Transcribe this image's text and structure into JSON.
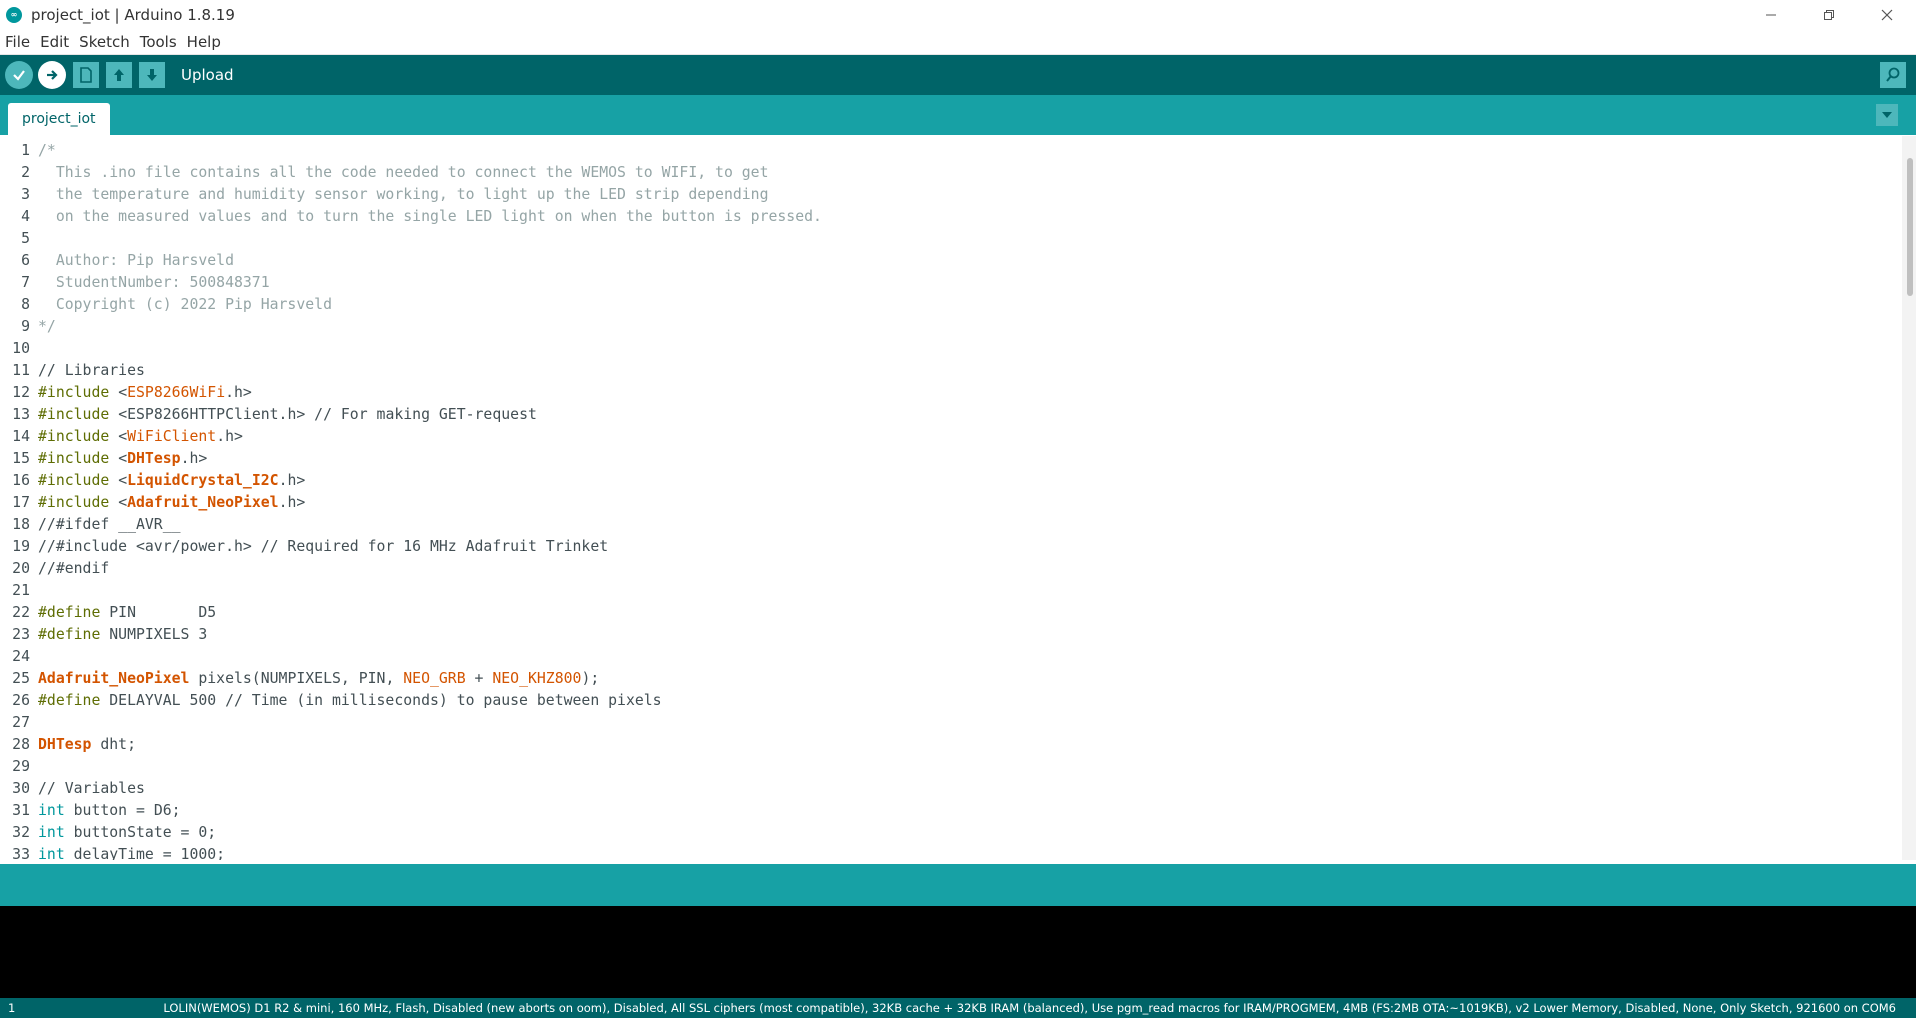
{
  "window": {
    "title": "project_iot | Arduino 1.8.19",
    "controls": [
      "minimize-icon",
      "restore-icon",
      "close-icon"
    ]
  },
  "menu": [
    "File",
    "Edit",
    "Sketch",
    "Tools",
    "Help"
  ],
  "toolbar": {
    "hover_label": "Upload",
    "buttons": [
      "verify-icon",
      "upload-icon",
      "new-icon",
      "open-icon",
      "save-icon"
    ],
    "serial_monitor_icon": "magnifier-icon"
  },
  "tabs": [
    {
      "label": "project_iot"
    }
  ],
  "editor": {
    "lines": [
      {
        "n": "1",
        "segs": [
          [
            "cm",
            "/*"
          ]
        ]
      },
      {
        "n": "2",
        "segs": [
          [
            "cm",
            "  This .ino file contains all the code needed to connect the WEMOS to WIFI, to get"
          ]
        ]
      },
      {
        "n": "3",
        "segs": [
          [
            "cm",
            "  the temperature and humidity sensor working, to light up the LED strip depending"
          ]
        ]
      },
      {
        "n": "4",
        "segs": [
          [
            "cm",
            "  on the measured values and to turn the single LED light on when the button is pressed."
          ]
        ]
      },
      {
        "n": "5",
        "segs": [
          [
            "cm",
            ""
          ]
        ]
      },
      {
        "n": "6",
        "segs": [
          [
            "cm",
            "  Author: Pip Harsveld"
          ]
        ]
      },
      {
        "n": "7",
        "segs": [
          [
            "cm",
            "  StudentNumber: 500848371"
          ]
        ]
      },
      {
        "n": "8",
        "segs": [
          [
            "cm",
            "  Copyright (c) 2022 Pip Harsveld"
          ]
        ]
      },
      {
        "n": "9",
        "segs": [
          [
            "cm",
            "*/"
          ]
        ]
      },
      {
        "n": "10",
        "segs": []
      },
      {
        "n": "11",
        "segs": [
          [
            "",
            "// Libraries"
          ]
        ]
      },
      {
        "n": "12",
        "segs": [
          [
            "pp",
            "#include"
          ],
          [
            "",
            " <"
          ],
          [
            "cls",
            "ESP8266WiFi"
          ],
          [
            "",
            ".h>"
          ]
        ]
      },
      {
        "n": "13",
        "segs": [
          [
            "pp",
            "#include"
          ],
          [
            "",
            " <ESP8266HTTPClient.h> // For making GET-request"
          ]
        ]
      },
      {
        "n": "14",
        "segs": [
          [
            "pp",
            "#include"
          ],
          [
            "",
            " <"
          ],
          [
            "cls",
            "WiFiClient"
          ],
          [
            "",
            ".h>"
          ]
        ]
      },
      {
        "n": "15",
        "segs": [
          [
            "pp",
            "#include"
          ],
          [
            "",
            " <"
          ],
          [
            "cls-b",
            "DHTesp"
          ],
          [
            "",
            ".h>"
          ]
        ]
      },
      {
        "n": "16",
        "segs": [
          [
            "pp",
            "#include"
          ],
          [
            "",
            " <"
          ],
          [
            "cls-b",
            "LiquidCrystal_I2C"
          ],
          [
            "",
            ".h>"
          ]
        ]
      },
      {
        "n": "17",
        "segs": [
          [
            "pp",
            "#include"
          ],
          [
            "",
            " <"
          ],
          [
            "cls-b",
            "Adafruit_NeoPixel"
          ],
          [
            "",
            ".h>"
          ]
        ]
      },
      {
        "n": "18",
        "segs": [
          [
            "",
            "//#ifdef __AVR__"
          ]
        ]
      },
      {
        "n": "19",
        "segs": [
          [
            "",
            "//#include <avr/power.h> // Required for 16 MHz Adafruit Trinket"
          ]
        ]
      },
      {
        "n": "20",
        "segs": [
          [
            "",
            "//#endif"
          ]
        ]
      },
      {
        "n": "21",
        "segs": []
      },
      {
        "n": "22",
        "segs": [
          [
            "pp",
            "#define"
          ],
          [
            "",
            " PIN       D5"
          ]
        ]
      },
      {
        "n": "23",
        "segs": [
          [
            "pp",
            "#define"
          ],
          [
            "",
            " NUMPIXELS 3"
          ]
        ]
      },
      {
        "n": "24",
        "segs": []
      },
      {
        "n": "25",
        "segs": [
          [
            "cls-b",
            "Adafruit_NeoPixel"
          ],
          [
            "",
            " pixels(NUMPIXELS, PIN, "
          ],
          [
            "cls",
            "NEO_GRB"
          ],
          [
            "",
            " + "
          ],
          [
            "cls",
            "NEO_KHZ800"
          ],
          [
            "",
            ");"
          ]
        ]
      },
      {
        "n": "26",
        "segs": [
          [
            "pp",
            "#define"
          ],
          [
            "",
            " DELAYVAL 500 // Time (in milliseconds) to pause between pixels"
          ]
        ]
      },
      {
        "n": "27",
        "segs": []
      },
      {
        "n": "28",
        "segs": [
          [
            "cls-b",
            "DHTesp"
          ],
          [
            "",
            " dht;"
          ]
        ]
      },
      {
        "n": "29",
        "segs": []
      },
      {
        "n": "30",
        "segs": [
          [
            "",
            "// Variables"
          ]
        ]
      },
      {
        "n": "31",
        "segs": [
          [
            "ty",
            "int"
          ],
          [
            "",
            " button = D6;"
          ]
        ]
      },
      {
        "n": "32",
        "segs": [
          [
            "ty",
            "int"
          ],
          [
            "",
            " buttonState = 0;"
          ]
        ]
      },
      {
        "n": "33",
        "segs": [
          [
            "ty",
            "int"
          ],
          [
            "",
            " delayTime = 1000;"
          ]
        ]
      }
    ]
  },
  "status": {
    "line_number": "1",
    "board_info": "LOLIN(WEMOS) D1 R2 & mini, 160 MHz, Flash, Disabled (new aborts on oom), Disabled, All SSL ciphers (most compatible), 32KB cache + 32KB IRAM (balanced), Use pgm_read macros for IRAM/PROGMEM, 4MB (FS:2MB OTA:~1019KB), v2 Lower Memory, Disabled, None, Only Sketch, 921600 on COM6"
  },
  "colors": {
    "toolbar": "#006468",
    "tabbar": "#17a1a5",
    "button": "#4db7bb",
    "console": "#000000"
  }
}
